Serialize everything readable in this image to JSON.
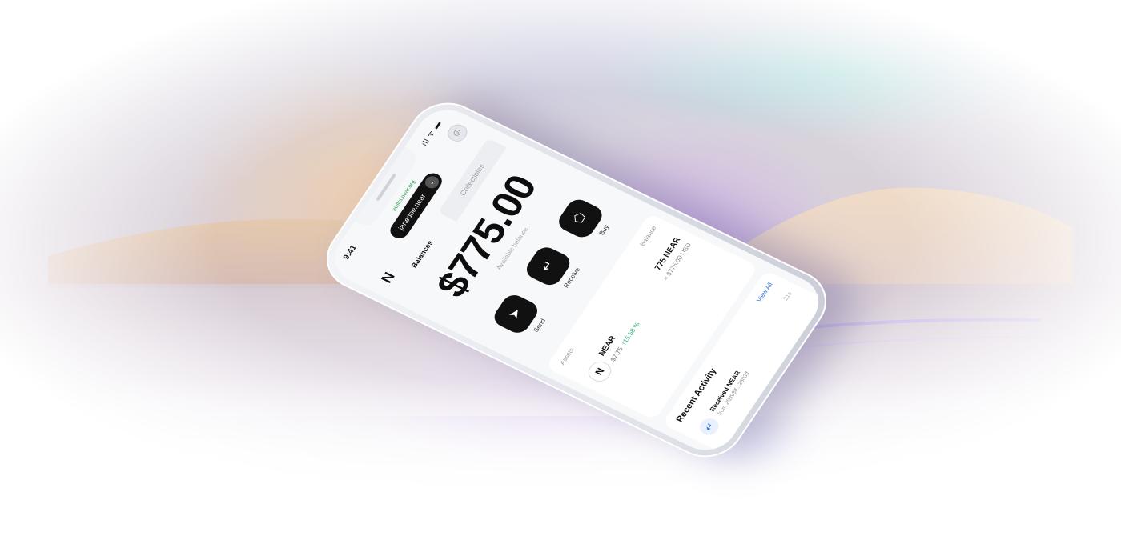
{
  "status": {
    "time": "9:41",
    "icons": "ıll ᯤ ▬"
  },
  "browser": {
    "url": "wallet.near.org"
  },
  "header": {
    "logo": "N",
    "account": "janedoe.near",
    "chevron": "⌄",
    "avatar": "◎"
  },
  "tabs": [
    {
      "label": "Balances"
    },
    {
      "label": "Collectibles"
    }
  ],
  "balance": {
    "amount": "$775.00",
    "label": "Available balance"
  },
  "actions": [
    {
      "label": "Send",
      "icon": "paper-plane-icon",
      "glyph": "➤"
    },
    {
      "label": "Receive",
      "icon": "receive-arrow-icon",
      "glyph": "↵"
    },
    {
      "label": "Buy",
      "icon": "tag-icon",
      "glyph": "⬠"
    }
  ],
  "assets": {
    "title": "Assets",
    "balance_header": "Balance",
    "rows": [
      {
        "symbol": "NEAR",
        "logo": "N",
        "price": "$7.75",
        "change": "↑15.58 %",
        "balance": "775 NEAR",
        "usd": "≈ $775.00 USD"
      }
    ]
  },
  "activity": {
    "title": "Recent Activity",
    "view_all": "View All",
    "items": [
      {
        "title": "Received NEAR",
        "from": "from 2f2f93ff...2303ff",
        "time": "21s"
      }
    ]
  },
  "colors": {
    "accent": "#111111",
    "positive": "#2eaa72",
    "link": "#2f6fde",
    "url": "#2e9b4e"
  }
}
